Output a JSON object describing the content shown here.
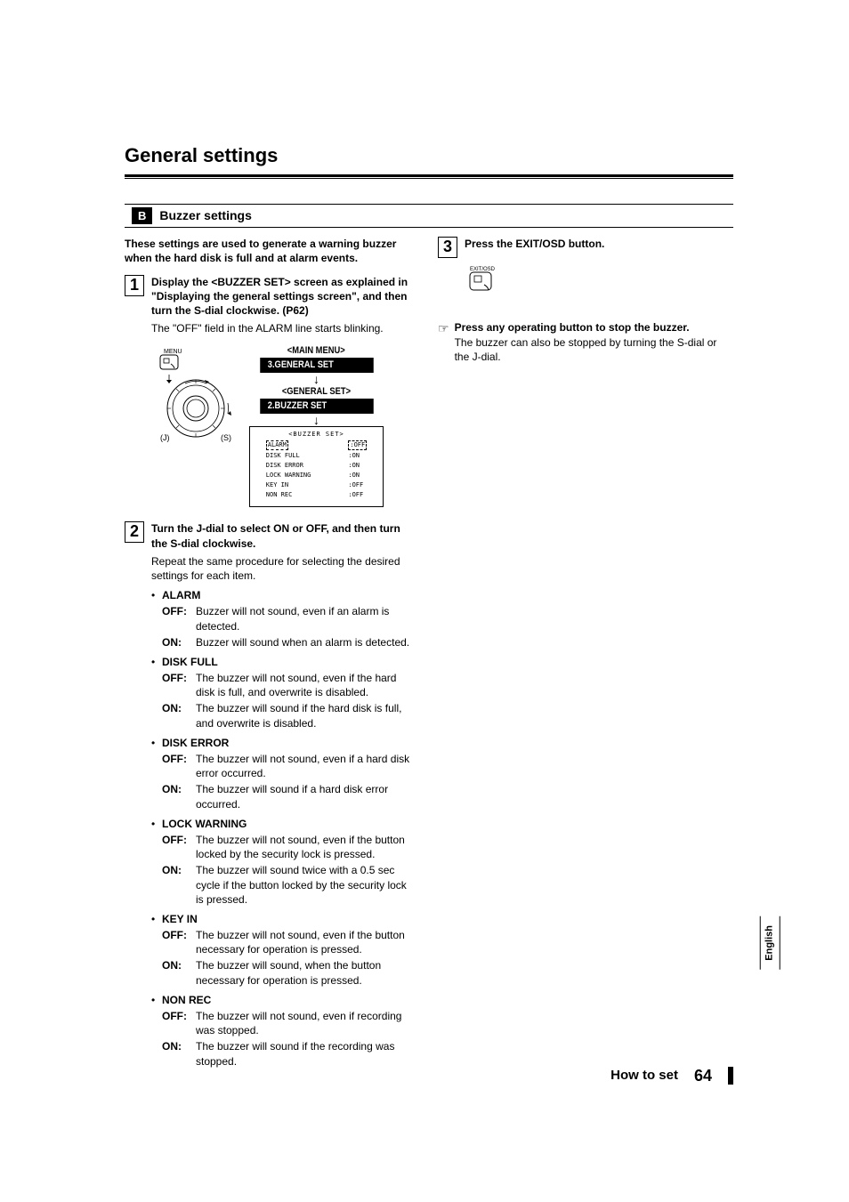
{
  "page_title": "General settings",
  "section": {
    "tag": "B",
    "title": "Buzzer settings"
  },
  "intro": "These settings are used to generate a warning buzzer when the hard disk is full and at alarm events.",
  "step1": {
    "no": "1",
    "text_bold": "Display the <BUZZER SET> screen as explained in \"Displaying the general settings screen\", and then turn the S-dial clockwise. (P62)",
    "text_sub": "The \"OFF\" field in the ALARM line starts blinking."
  },
  "dial": {
    "menu_label": "MENU",
    "j_label": "(J)",
    "s_label": "(S)"
  },
  "menu_stack": {
    "h1": "<MAIN MENU>",
    "b1": "3.GENERAL SET",
    "h2": "<GENERAL SET>",
    "b2": "2.BUZZER SET"
  },
  "osd": {
    "title": "<BUZZER SET>",
    "rows": [
      {
        "k": "ALARM",
        "v": ":OFF",
        "dashed": true
      },
      {
        "k": "DISK FULL",
        "v": ":ON"
      },
      {
        "k": "DISK ERROR",
        "v": ":ON"
      },
      {
        "k": "LOCK WARNING",
        "v": ":ON"
      },
      {
        "k": "KEY IN",
        "v": ":OFF"
      },
      {
        "k": "NON REC",
        "v": ":OFF"
      }
    ]
  },
  "step2": {
    "no": "2",
    "text_bold": "Turn the J-dial to select ON or OFF, and then turn the S-dial clockwise.",
    "text_sub": "Repeat the same procedure for selecting the desired settings for each item."
  },
  "items": [
    {
      "title": "ALARM",
      "off": "Buzzer will not sound, even if an alarm is detected.",
      "on": "Buzzer will sound when an alarm is detected."
    },
    {
      "title": "DISK FULL",
      "off": "The buzzer will not sound, even if the hard disk is full, and overwrite is disabled.",
      "on": "The buzzer will sound if the hard disk is full, and overwrite is disabled."
    },
    {
      "title": "DISK ERROR",
      "off": "The buzzer will not sound, even if a hard disk error occurred.",
      "on": "The buzzer will sound if a hard disk error occurred."
    },
    {
      "title": "LOCK WARNING",
      "off": "The buzzer will not sound, even if the button locked by the security lock is pressed.",
      "on": "The buzzer will sound twice with a 0.5 sec cycle if the button locked by the security lock is pressed."
    },
    {
      "title": "KEY IN",
      "off": "The buzzer will not sound, even if the button necessary for operation is pressed.",
      "on": "The buzzer will sound, when the button necessary for operation is pressed."
    },
    {
      "title": "NON REC",
      "off": "The buzzer will not sound, even if recording was stopped.",
      "on": "The buzzer will sound if the recording was stopped."
    }
  ],
  "step3": {
    "no": "3",
    "text_bold": "Press the EXIT/OSD button.",
    "exit_label": "EXIT/OSD"
  },
  "note": {
    "bold": "Press any operating button to stop the buzzer.",
    "text": "The buzzer can also be stopped by turning the S-dial or the J-dial."
  },
  "lang_tab": "English",
  "footer": {
    "label": "How to set",
    "page": "64"
  }
}
